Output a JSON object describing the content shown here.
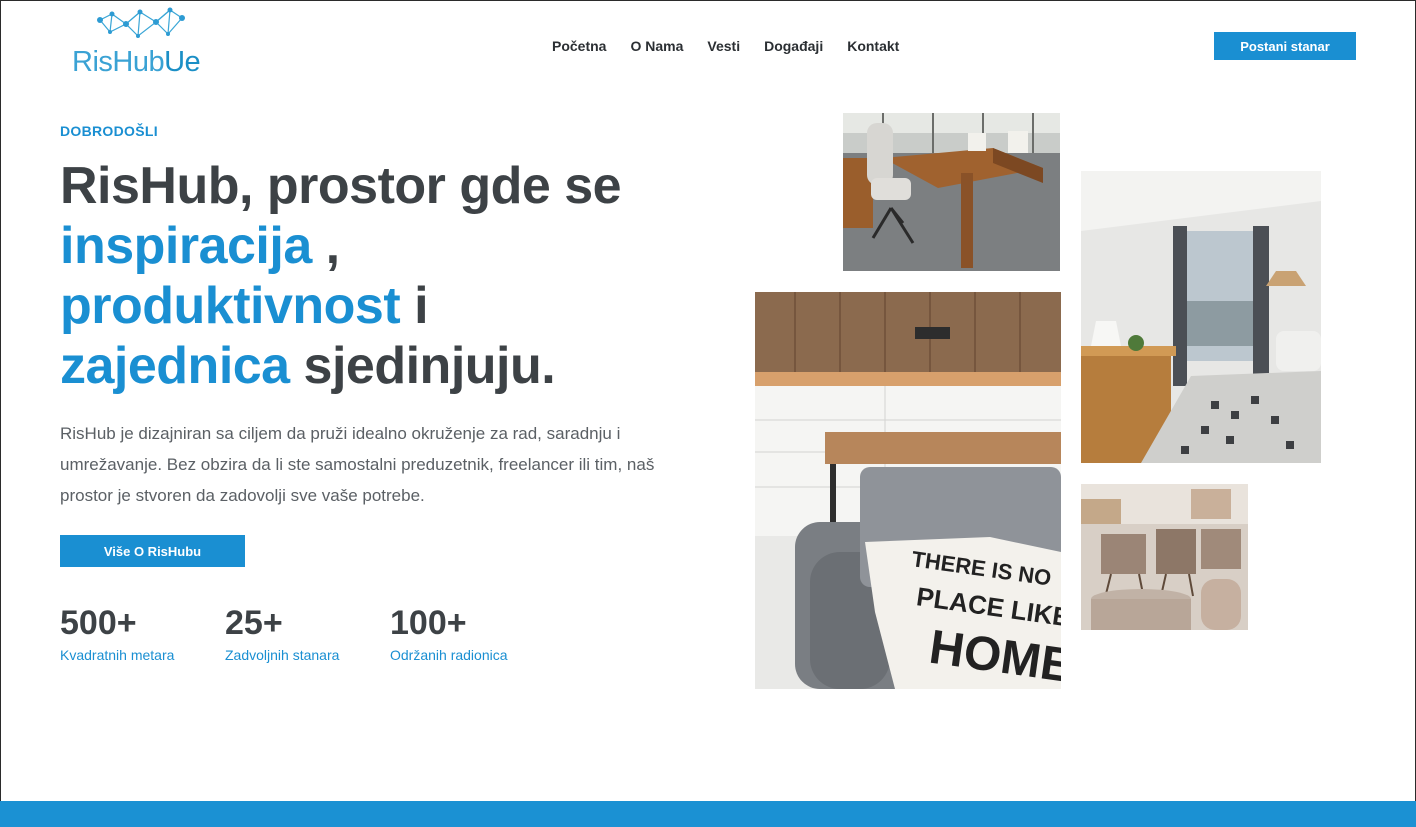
{
  "brand": {
    "logo_part1": "RisHub",
    "logo_part2": "Ue",
    "accent": "#1a8fd2"
  },
  "nav": {
    "items": [
      "Početna",
      "O Nama",
      "Vesti",
      "Događaji",
      "Kontakt"
    ],
    "cta": "Postani stanar"
  },
  "hero": {
    "eyebrow": "DOBRODOŠLI",
    "headline": {
      "part1": "RisHub, prostor gde se",
      "hl1": "inspiracija",
      "part2": " ,",
      "hl2": "produktivnost",
      "part3": " i",
      "hl3": "zajednica",
      "part4": " sjedinjuju."
    },
    "description": "RisHub je dizajniran sa ciljem da pruži idealno okruženje za rad, saradnju i umrežavanje. Bez obzira da li ste samostalni preduzetnik, freelancer ili tim, naš prostor je stvoren da zadovolji sve vaše potrebe.",
    "button": "Više O RisHubu"
  },
  "stats": [
    {
      "value": "500+",
      "label": "Kvadratnih metara"
    },
    {
      "value": "25+",
      "label": "Zadvoljnih stanara"
    },
    {
      "value": "100+",
      "label": "Održanih radionica"
    }
  ],
  "pillow_text": [
    "THERE IS NO",
    "PLACE LIKE",
    "HOME"
  ]
}
